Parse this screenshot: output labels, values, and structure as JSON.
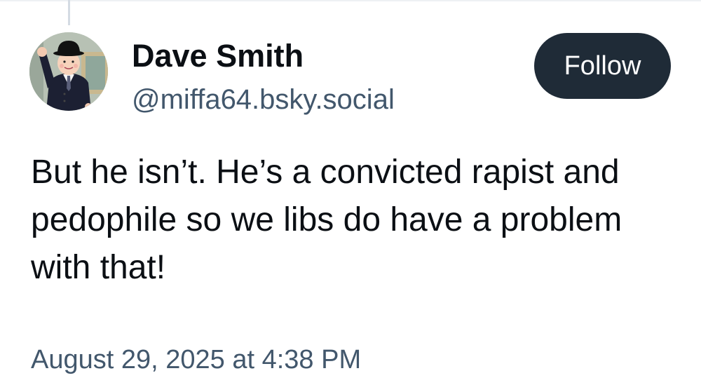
{
  "post": {
    "author": {
      "display_name": "Dave Smith",
      "handle": "@miffa64.bsky.social",
      "avatar_icon": "cartoon-man-bowler-hat-avatar"
    },
    "follow_label": "Follow",
    "text": "But he isn’t. He’s a convicted rapist and pedophile so we libs do have a problem with that!",
    "timestamp": "August 29, 2025 at 4:38 PM"
  },
  "colors": {
    "follow_button_bg": "#1f2b37",
    "handle_text": "#42576c",
    "body_text": "#0b0f14",
    "thread_line": "#d4dbe3"
  }
}
